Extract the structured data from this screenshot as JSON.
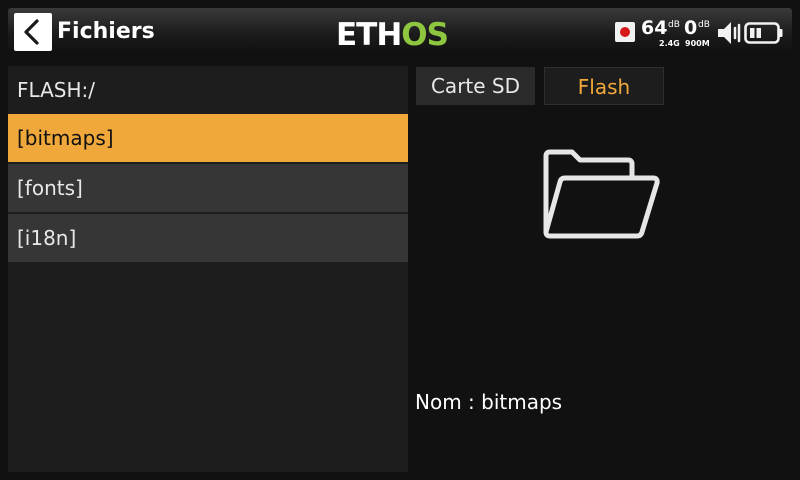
{
  "header": {
    "title": "Fichiers",
    "brand": "ETHOS",
    "telemetry": {
      "rssi_1": "64",
      "rssi_1_unit": "dB",
      "rssi_2": "0",
      "rssi_2_unit": "dB",
      "band_1": "2.4G",
      "band_2": "900M"
    }
  },
  "left": {
    "path": "FLASH:/",
    "items": [
      {
        "label": "[bitmaps]"
      },
      {
        "label": "[fonts]"
      },
      {
        "label": "[i18n]"
      }
    ],
    "selected_index": 0
  },
  "right": {
    "tabs": [
      {
        "label": "Carte SD"
      },
      {
        "label": "Flash"
      }
    ],
    "active_tab": 1,
    "name_label": "Nom : bitmaps"
  },
  "colors": {
    "accent": "#f0a83a",
    "brand_green": "#8fc63f",
    "record_red": "#d81818"
  },
  "icons": {
    "back": "chevron-left-icon",
    "record": "record-icon",
    "volume": "speaker-icon",
    "battery": "battery-icon",
    "preview": "folder-open-icon"
  }
}
